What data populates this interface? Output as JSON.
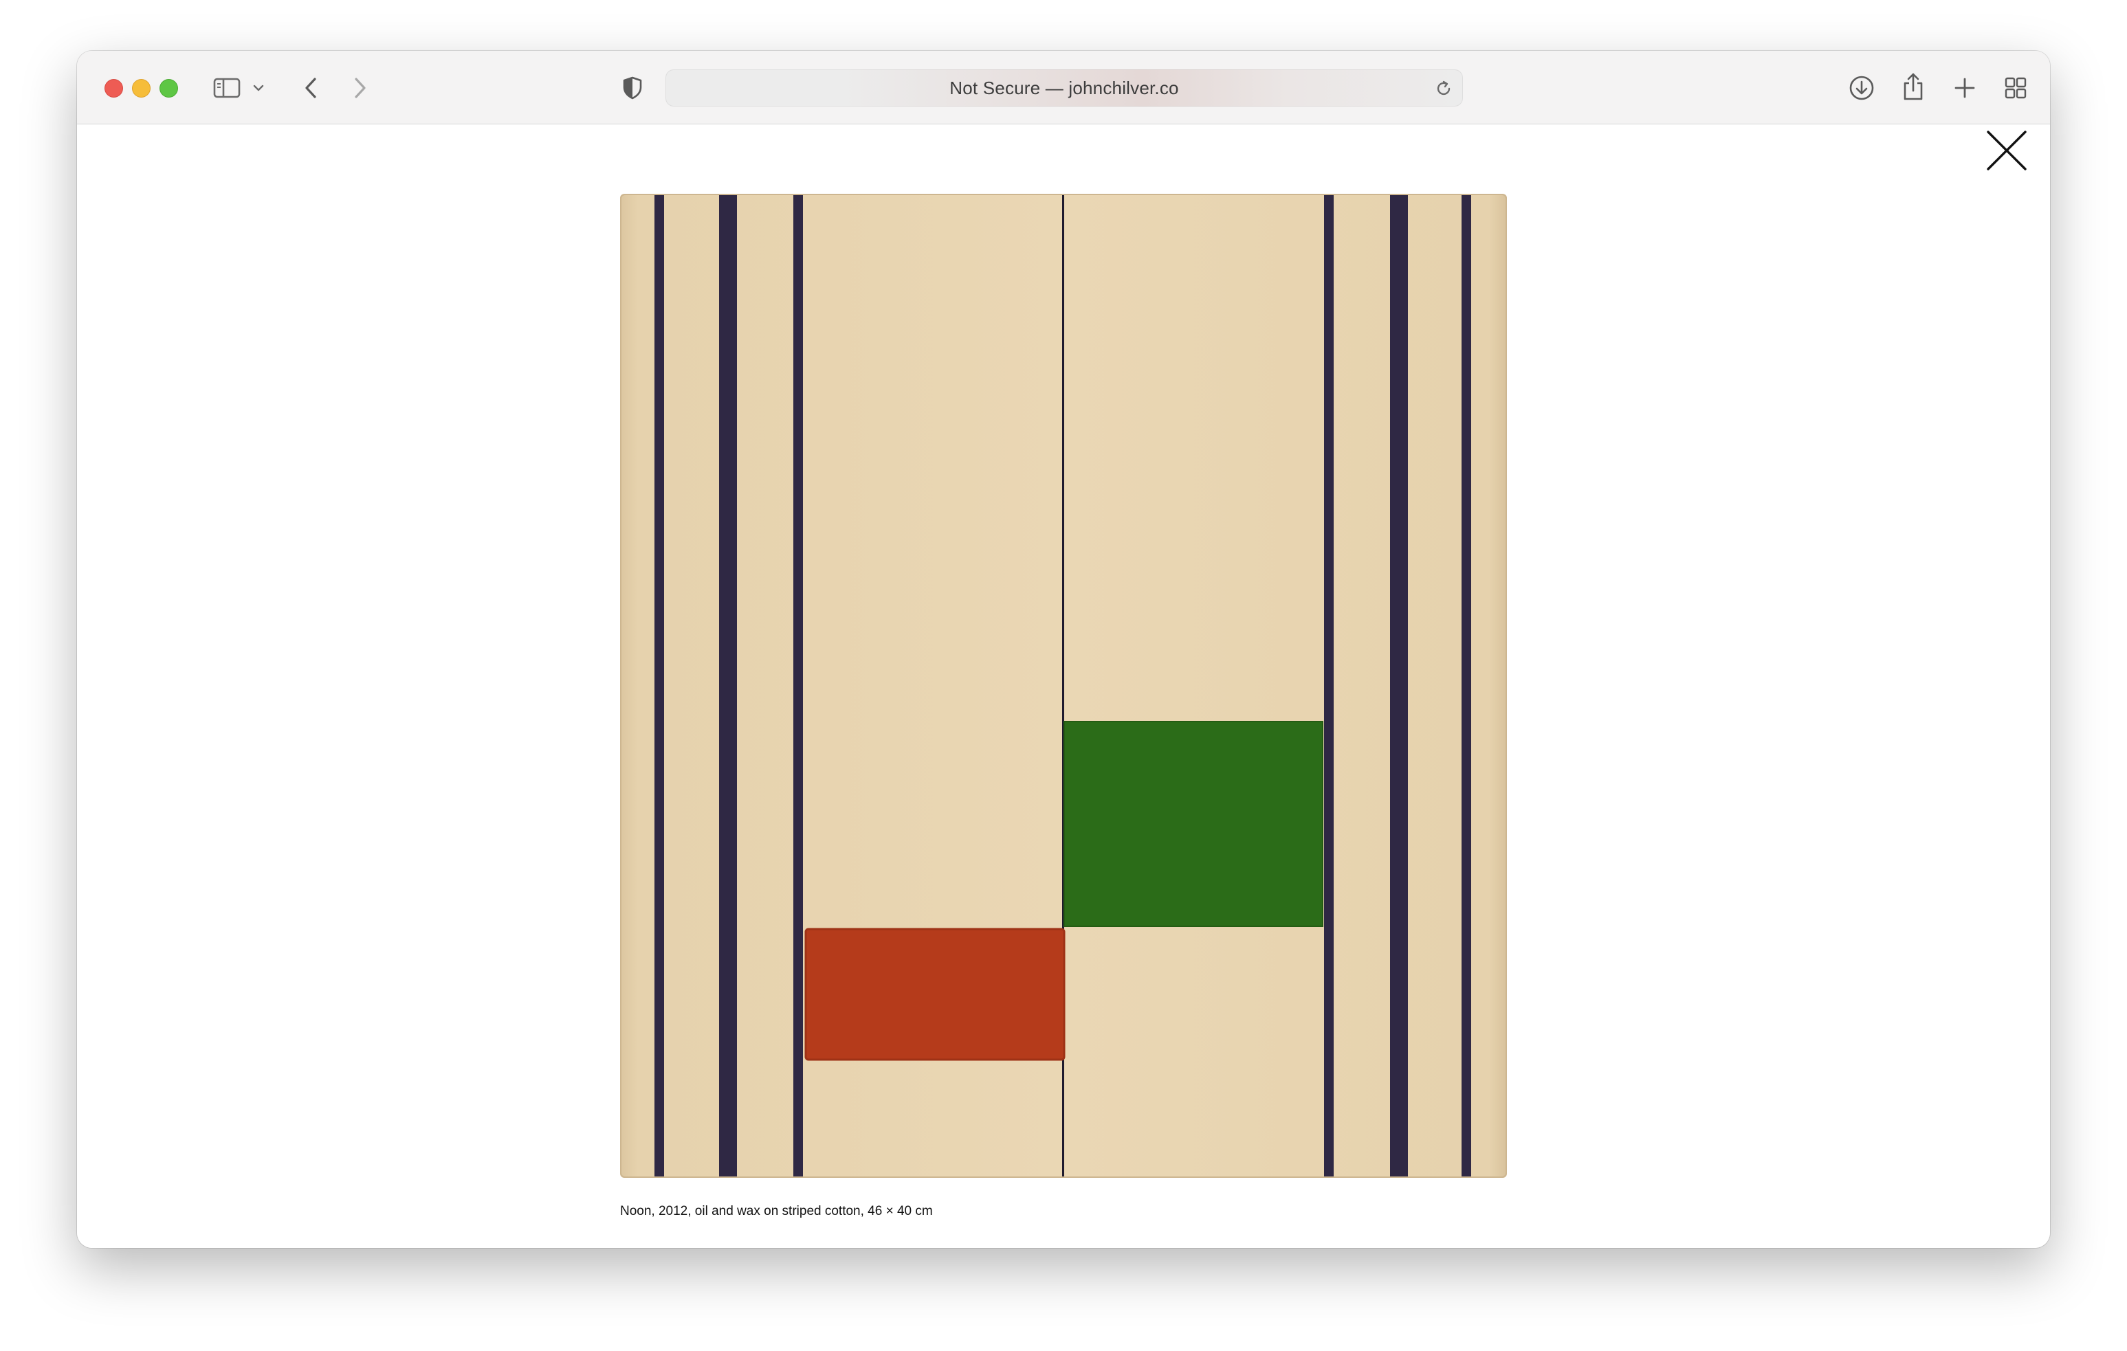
{
  "window": {
    "address": "Not Secure — johnchilver.co"
  },
  "icons": {
    "sidebar": "sidebar-icon",
    "chevron": "chevron-down-icon",
    "back": "back-arrow-icon",
    "forward": "forward-arrow-icon",
    "privacy": "shield-icon",
    "reload": "reload-icon",
    "download": "download-icon",
    "share": "share-icon",
    "new_tab": "plus-icon",
    "tab_overview": "grid-icon",
    "close": "close-icon"
  },
  "colors": {
    "canvas": "#e7d3b0",
    "stripe": "#2f2844",
    "red_block": "#b53b1b",
    "green_block": "#2b6c18"
  },
  "artwork": {
    "caption": "Noon, 2012, oil and wax on striped cotton, 46 × 40 cm"
  }
}
